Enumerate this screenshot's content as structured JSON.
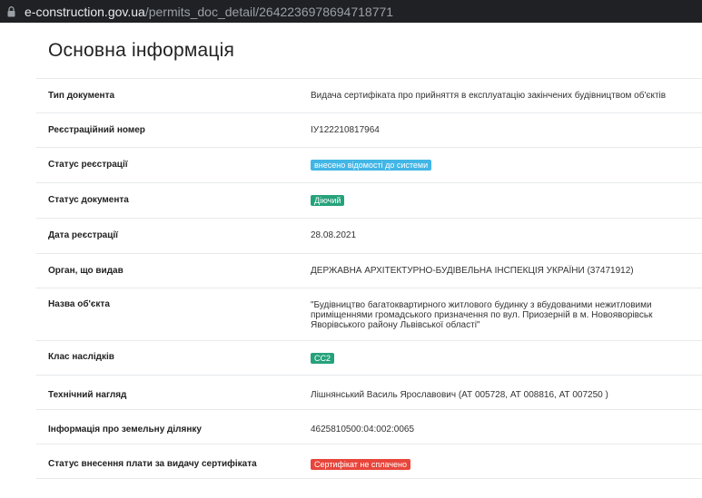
{
  "browser": {
    "url_domain": "e-construction.gov.ua",
    "url_path": "/permits_doc_detail/2642236978694718771"
  },
  "page": {
    "title": "Основна інформація"
  },
  "rows": [
    {
      "label": "Тип документа",
      "value": "Видача сертифіката про прийняття в експлуатацію закінчених будівництвом об'єктів"
    },
    {
      "label": "Реєстраційний номер",
      "value": "ІУ122210817964"
    },
    {
      "label": "Статус реєстрації",
      "value": "внесено відомості до системи",
      "badge_color": "#42b6e6"
    },
    {
      "label": "Статус документа",
      "value": "Діючий",
      "badge_color": "#26a27b"
    },
    {
      "label": "Дата реєстрації",
      "value": "28.08.2021"
    },
    {
      "label": "Орган, що видав",
      "value": "ДЕРЖАВНА АРХІТЕКТУРНО-БУДІВЕЛЬНА ІНСПЕКЦІЯ УКРАЇНИ (37471912)"
    },
    {
      "label": "Назва об'єкта",
      "value_lines": [
        "\"Будівництво багатоквартирного житлового будинку з вбудованими нежитловими",
        "приміщеннями громадського призначення по вул. Приозерній в м. Новояворівськ",
        "Яворівського району Львівської області\""
      ]
    },
    {
      "label": "Клас наслідків",
      "value": "СС2",
      "badge_color": "#26a27b"
    },
    {
      "label": "Технічний нагляд",
      "value": "Лішнянський Василь Ярославович (АТ 005728, АТ 008816, АТ 007250 )"
    },
    {
      "label": "Інформація про земельну ділянку",
      "value": "4625810500:04:002:0065"
    },
    {
      "label": "Статус внесення плати за видачу сертифіката",
      "value": "Сертифікат не сплачено",
      "badge_color": "#e8453b"
    }
  ]
}
